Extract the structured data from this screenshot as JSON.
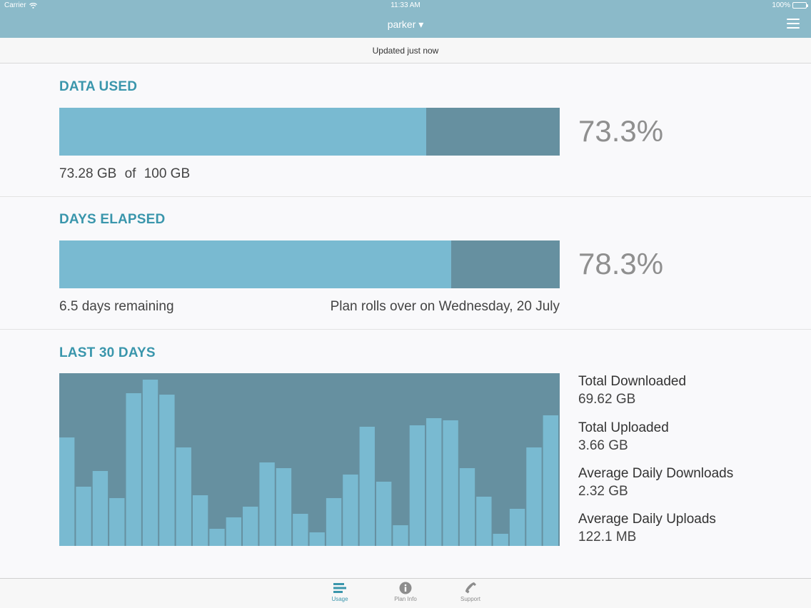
{
  "status_bar": {
    "carrier": "Carrier",
    "time": "11:33 AM",
    "battery": "100%"
  },
  "header": {
    "account": "parker ▾",
    "menu_icon": "hamburger-menu-icon"
  },
  "update_status": "Updated just now",
  "data_used": {
    "title": "DATA USED",
    "fraction": 0.733,
    "percent_label": "73.3%",
    "used": "73.28 GB",
    "of": "of",
    "total": "100 GB"
  },
  "days_elapsed": {
    "title": "DAYS ELAPSED",
    "fraction": 0.783,
    "percent_label": "78.3%",
    "remaining": "6.5 days remaining",
    "rollover": "Plan rolls over on Wednesday, 20 July"
  },
  "last30": {
    "title": "LAST 30 DAYS",
    "stats": [
      {
        "label": "Total Downloaded",
        "value": "69.62 GB"
      },
      {
        "label": "Total Uploaded",
        "value": "3.66 GB"
      },
      {
        "label": "Average Daily Downloads",
        "value": "2.32 GB"
      },
      {
        "label": "Average Daily Uploads",
        "value": "122.1 MB"
      }
    ]
  },
  "chart_data": {
    "type": "bar",
    "ylim": [
      0,
      1
    ],
    "values": [
      0.64,
      0.35,
      0.44,
      0.28,
      0.9,
      0.98,
      0.89,
      0.58,
      0.3,
      0.1,
      0.17,
      0.23,
      0.49,
      0.46,
      0.19,
      0.08,
      0.28,
      0.42,
      0.7,
      0.38,
      0.12,
      0.71,
      0.75,
      0.74,
      0.46,
      0.29,
      0.07,
      0.22,
      0.58,
      0.77
    ]
  },
  "tabs": [
    {
      "label": "Usage",
      "icon": "usage-icon",
      "active": true
    },
    {
      "label": "Plan Info",
      "icon": "info-icon",
      "active": false
    },
    {
      "label": "Support",
      "icon": "phone-icon",
      "active": false
    }
  ],
  "colors": {
    "header": "#8bbac9",
    "accent": "#3a96ac",
    "bar_fill": "#79bad1",
    "bar_track": "#6690a0"
  }
}
